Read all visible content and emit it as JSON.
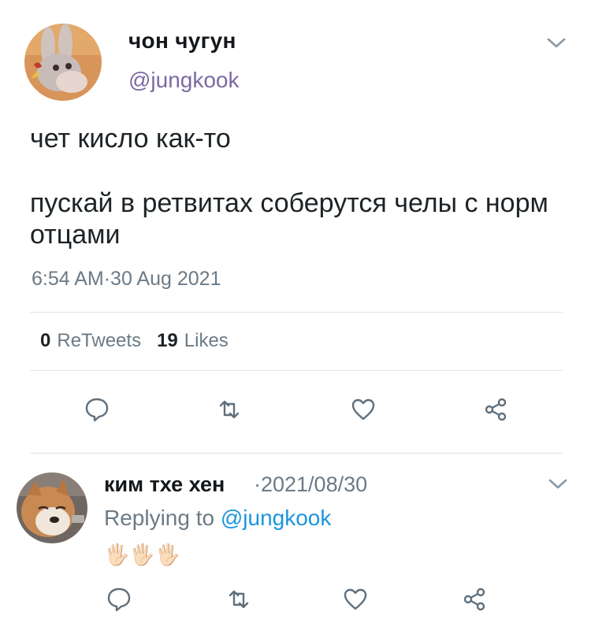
{
  "tweet": {
    "display_name": "чон чугун",
    "handle": "@jungkook",
    "text_line1": "чет кисло как-то",
    "text_line2": "пускай в ретвитах соберутся челы с норм отцами",
    "timestamp": "6:54 AM·30 Aug 2021",
    "retweets_count": "0",
    "retweets_label": "ReTweets",
    "likes_count": "19",
    "likes_label": "Likes"
  },
  "reply": {
    "display_name": "ким тхе хен",
    "date": "·2021/08/30",
    "replying_prefix": "Replying to ",
    "replying_mention": "@jungkook",
    "text": "🖐🏻🖐🏻🖐🏻"
  },
  "icons": [
    "reply-icon",
    "retweet-icon",
    "like-icon",
    "share-icon",
    "chevron-down-icon"
  ],
  "colors": {
    "handle": "#7a6aa1",
    "mention": "#1b95e0",
    "secondary": "#6b7a86",
    "icon": "#5f6f7c"
  }
}
